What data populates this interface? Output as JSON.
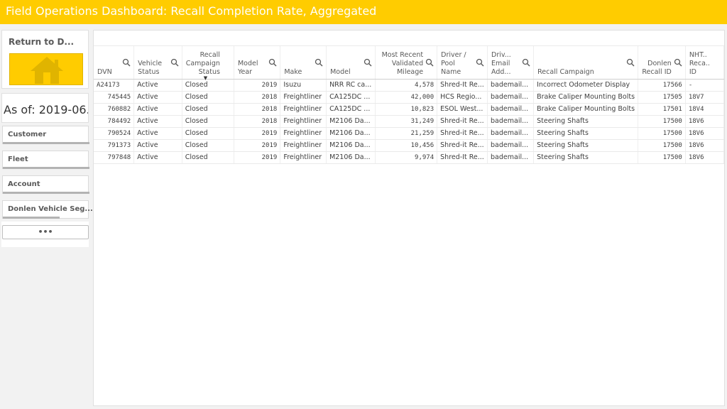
{
  "header": {
    "title": "Field Operations Dashboard: Recall Completion Rate, Aggregated"
  },
  "sidebar": {
    "return_label": "Return to D...",
    "home_icon": "home-icon",
    "as_of": "As of: 2019-06...",
    "filters": [
      {
        "label": "Customer"
      },
      {
        "label": "Fleet"
      },
      {
        "label": "Account"
      },
      {
        "label": "Donlen Vehicle Seg..."
      }
    ],
    "more_label": "•••"
  },
  "colors": {
    "brand": "#ffcc00",
    "text": "#404040"
  },
  "table": {
    "columns": [
      {
        "label": "DVN",
        "search": true,
        "align": "left"
      },
      {
        "label": "Vehicle Status",
        "search": true,
        "align": "left"
      },
      {
        "label": "Recall Campaign Status",
        "search": false,
        "align": "right"
      },
      {
        "label": "Model Year",
        "search": true,
        "align": "left"
      },
      {
        "label": "Make",
        "search": true,
        "align": "left"
      },
      {
        "label": "Model",
        "search": true,
        "align": "left"
      },
      {
        "label": "Most Recent Validated Mileage",
        "search": true,
        "align": "right"
      },
      {
        "label": "Driver / Pool Name",
        "search": true,
        "align": "left"
      },
      {
        "label": "Driv... Email Add...",
        "search": true,
        "align": "left"
      },
      {
        "label": "Recall Campaign",
        "search": true,
        "align": "left"
      },
      {
        "label": "Donlen Recall ID",
        "search": true,
        "align": "right"
      },
      {
        "label": "NHT.. Reca.. ID",
        "search": false,
        "align": "left"
      }
    ],
    "rows": [
      [
        "A24173",
        "Active",
        "Closed",
        "2019",
        "Isuzu",
        "NRR RC ca...",
        "4,578",
        "Shred-It Re...",
        "bademail...",
        "Incorrect Odometer Display",
        "17566",
        "-"
      ],
      [
        "745445",
        "Active",
        "Closed",
        "2018",
        "Freightliner",
        "CA125DC ...",
        "42,000",
        "HCS Regio...",
        "bademail...",
        "Brake Caliper Mounting Bolts",
        "17505",
        "18V7"
      ],
      [
        "760882",
        "Active",
        "Closed",
        "2018",
        "Freightliner",
        "CA125DC ...",
        "10,823",
        "ESOL West...",
        "bademail...",
        "Brake Caliper Mounting Bolts",
        "17501",
        "18V4"
      ],
      [
        "784492",
        "Active",
        "Closed",
        "2018",
        "Freightliner",
        "M2106 Da...",
        "31,249",
        "Shred-it Re...",
        "bademail...",
        "Steering Shafts",
        "17500",
        "18V6"
      ],
      [
        "790524",
        "Active",
        "Closed",
        "2019",
        "Freightliner",
        "M2106 Da...",
        "21,259",
        "Shred-it Re...",
        "bademail...",
        "Steering Shafts",
        "17500",
        "18V6"
      ],
      [
        "791373",
        "Active",
        "Closed",
        "2019",
        "Freightliner",
        "M2106 Da...",
        "10,456",
        "Shred-it Re...",
        "bademail...",
        "Steering Shafts",
        "17500",
        "18V6"
      ],
      [
        "797848",
        "Active",
        "Closed",
        "2019",
        "Freightliner",
        "M2106 Da...",
        "9,974",
        "Shred-It Re...",
        "bademail...",
        "Steering Shafts",
        "17500",
        "18V6"
      ]
    ]
  }
}
